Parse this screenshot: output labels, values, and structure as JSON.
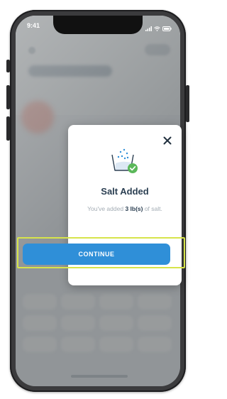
{
  "status_bar": {
    "time": "9:41",
    "icons": [
      "signal-icon",
      "wifi-icon",
      "battery-icon"
    ]
  },
  "modal": {
    "hero_icon": "salt-bin-check-icon",
    "close_icon": "close-icon",
    "title": "Salt Added",
    "message_prefix": "You've added ",
    "message_amount": "3 lb(s)",
    "message_suffix": " of salt.",
    "continue_label": "CONTINUE"
  },
  "colors": {
    "primary_button": "#2f8fd8",
    "title_text": "#2b3f52",
    "check_green": "#5bb85a",
    "highlight_outline": "#d7e44b"
  }
}
